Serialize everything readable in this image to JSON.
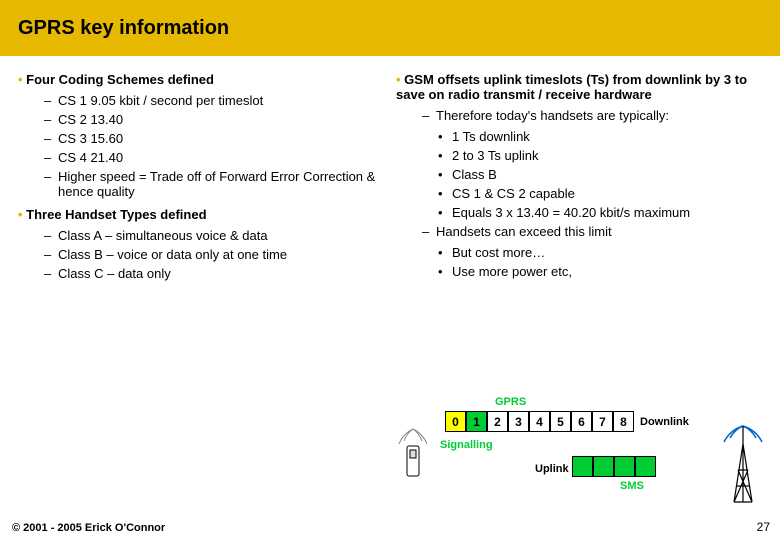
{
  "title": "GPRS key information",
  "left": {
    "h1": "Four Coding Schemes defined",
    "cs": [
      "CS 1  9.05 kbit / second per timeslot",
      "CS 2  13.40",
      "CS 3  15.60",
      "CS 4  21.40",
      "Higher speed = Trade off of Forward Error Correction & hence quality"
    ],
    "h2": "Three Handset Types defined",
    "classes": [
      "Class A – simultaneous voice & data",
      "Class B – voice or data only at one time",
      "Class C – data only"
    ]
  },
  "right": {
    "h1": "GSM offsets uplink timeslots (Ts) from downlink by 3 to save on radio transmit / receive hardware",
    "typ_intro": "Therefore today's handsets are typically:",
    "typ": [
      "1 Ts downlink",
      "2 to 3 Ts uplink",
      "Class B",
      "CS 1 & CS 2 capable",
      "Equals 3 x 13.40 = 40.20 kbit/s maximum"
    ],
    "exceed_intro": "Handsets can exceed this limit",
    "exceed": [
      "But cost more…",
      "Use more power etc,"
    ]
  },
  "diagram": {
    "gprs": "GPRS",
    "slots": [
      "0",
      "1",
      "2",
      "3",
      "4",
      "5",
      "6",
      "7",
      "8"
    ],
    "downlink": "Downlink",
    "signalling": "Signalling",
    "uplink": "Uplink",
    "sms": "SMS"
  },
  "footer": "© 2001 - 2005 Erick O'Connor",
  "page": "27"
}
